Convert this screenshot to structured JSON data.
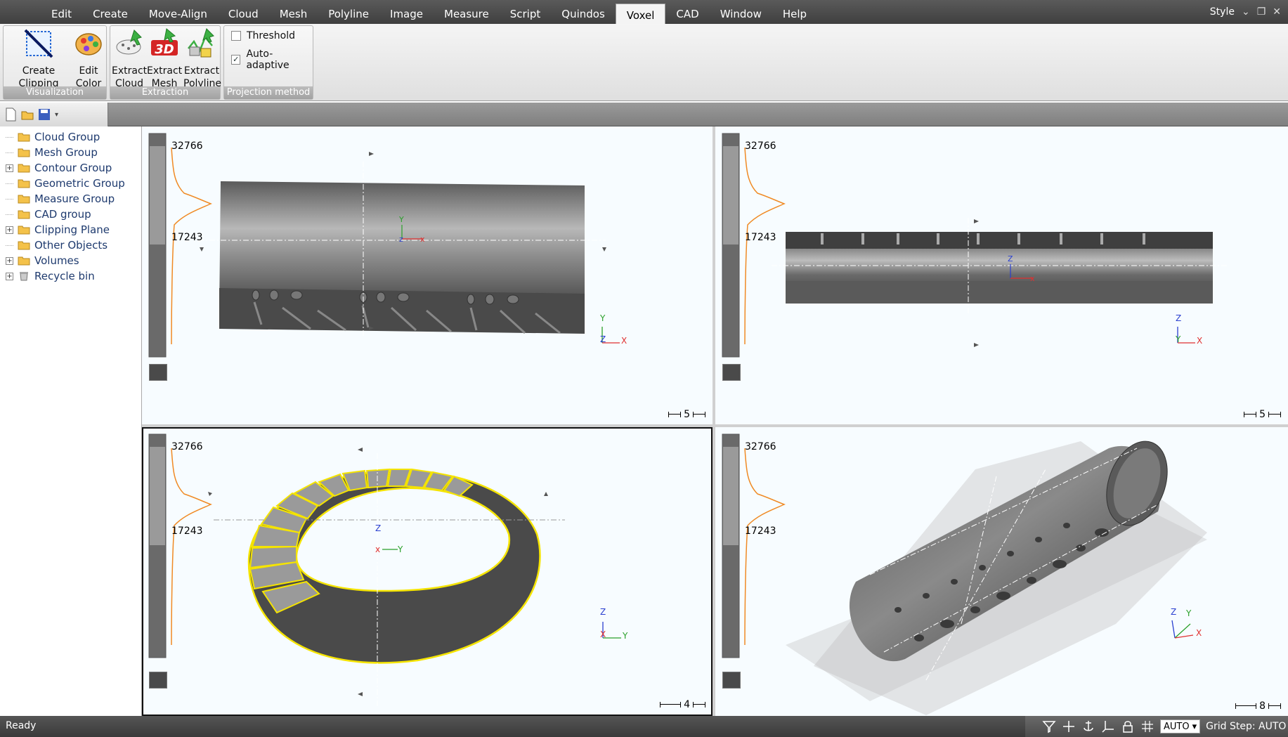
{
  "menubar": {
    "items": [
      "Edit",
      "Create",
      "Move-Align",
      "Cloud",
      "Mesh",
      "Polyline",
      "Image",
      "Measure",
      "Script",
      "Quindos",
      "Voxel",
      "CAD",
      "Window",
      "Help"
    ],
    "active": "Voxel",
    "style_label": "Style"
  },
  "ribbon": {
    "visualization": {
      "label": "Visualization",
      "create_clipping_plane": [
        "Create",
        "Clipping Plane"
      ],
      "edit_color": [
        "Edit",
        "Color"
      ]
    },
    "extraction": {
      "label": "Extraction",
      "extract_cloud": [
        "Extract",
        "Cloud"
      ],
      "extract_mesh": [
        "Extract",
        "Mesh"
      ],
      "extract_polyline": [
        "Extract",
        "Polyline"
      ]
    },
    "projection": {
      "label": "Projection method",
      "threshold": {
        "label": "Threshold",
        "checked": false
      },
      "auto_adaptive": {
        "label": "Auto-adaptive",
        "checked": true
      }
    }
  },
  "tree": {
    "items": [
      {
        "label": "Cloud Group",
        "expandable": false
      },
      {
        "label": "Mesh Group",
        "expandable": false
      },
      {
        "label": "Contour Group",
        "expandable": true
      },
      {
        "label": "Geometric Group",
        "expandable": false
      },
      {
        "label": "Measure Group",
        "expandable": false
      },
      {
        "label": "CAD group",
        "expandable": false
      },
      {
        "label": "Clipping Plane",
        "expandable": true
      },
      {
        "label": "Other Objects",
        "expandable": false
      },
      {
        "label": "Volumes",
        "expandable": true
      },
      {
        "label": "Recycle bin",
        "expandable": true
      }
    ]
  },
  "viewports": {
    "top_left": {
      "hist_max": "32766",
      "hist_mid": "17243",
      "scale": "5",
      "axis_a": "Y",
      "axis_b": "Z",
      "axis_c": "X"
    },
    "top_right": {
      "hist_max": "32766",
      "hist_mid": "17243",
      "scale": "5",
      "axis_a": "Z",
      "axis_b": "Y",
      "axis_c": "X"
    },
    "bottom_left": {
      "hist_max": "32766",
      "hist_mid": "17243",
      "scale": "4",
      "axis_a": "Z",
      "axis_b": "X",
      "axis_c": "Y"
    },
    "bottom_right": {
      "hist_max": "32766",
      "hist_mid": "17243",
      "scale": "8",
      "axis_a": "Z",
      "axis_b": "Y",
      "axis_c": "X"
    }
  },
  "statusbar": {
    "status": "Ready",
    "auto": "AUTO",
    "grid_step": "Grid Step: AUTO"
  },
  "colors": {
    "histogram_curve": "#f08a24",
    "contour": "#f5e400",
    "axis_x": "#e03030",
    "axis_y": "#2aa02a",
    "axis_z": "#2a3fd0"
  }
}
